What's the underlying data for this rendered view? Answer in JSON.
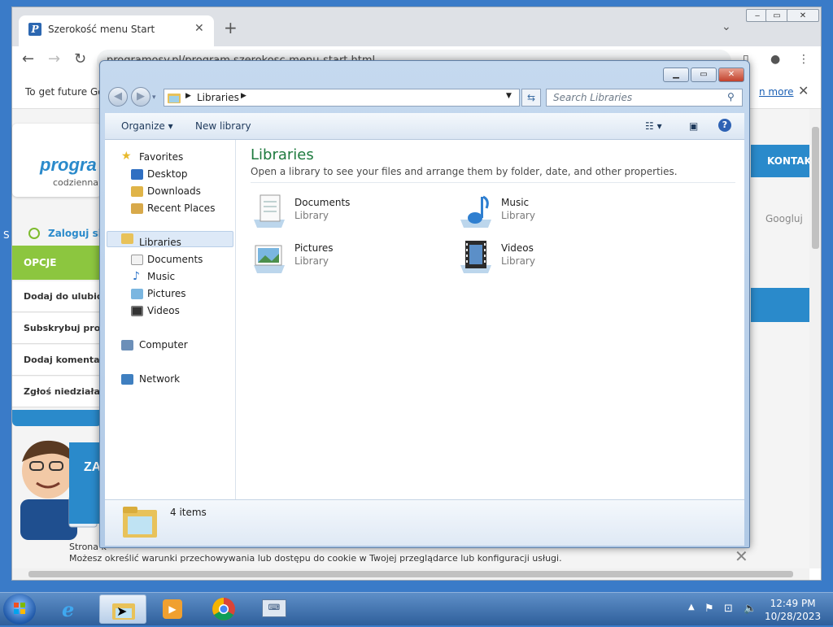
{
  "browser": {
    "tab_title": "Szerokość menu Start",
    "tab_favicon": "P",
    "url": "programosy.pl/program,szerokosc-menu-start.html",
    "infobar_text": "To get future Go",
    "infobar_link": "n more",
    "win_minimize": "‒",
    "win_maximize": "▭",
    "win_close": "✕"
  },
  "website": {
    "logo": "progra",
    "logo_sub": "codzienna",
    "login": "Zaloguj się",
    "options_header": "OPCJE PROGRA",
    "options": [
      "Dodaj do ulubion",
      "Subskrybuj progr",
      "Dodaj komentarz",
      "Zgłoś niedziałają"
    ],
    "promo": "ZA",
    "kontakt": "KONTAKT",
    "search_button": "Googluj",
    "cookie_line1": "Strona k",
    "cookie_line2": "Możesz określić warunki przechowywania lub dostępu do cookie w Twojej przeglądarce lub konfiguracji usługi.",
    "side_letter": "S"
  },
  "explorer": {
    "address": "Libraries",
    "search_placeholder": "Search Libraries",
    "toolbar": {
      "organize": "Organize",
      "new_library": "New library",
      "help": "?"
    },
    "nav": {
      "favorites": "Favorites",
      "favorites_items": [
        "Desktop",
        "Downloads",
        "Recent Places"
      ],
      "libraries": "Libraries",
      "libraries_items": [
        "Documents",
        "Music",
        "Pictures",
        "Videos"
      ],
      "computer": "Computer",
      "network": "Network"
    },
    "content": {
      "title": "Libraries",
      "description": "Open a library to see your files and arrange them by folder, date, and other properties.",
      "items": [
        {
          "name": "Documents",
          "type": "Library",
          "icon": "documents-library-icon"
        },
        {
          "name": "Music",
          "type": "Library",
          "icon": "music-library-icon"
        },
        {
          "name": "Pictures",
          "type": "Library",
          "icon": "pictures-library-icon"
        },
        {
          "name": "Videos",
          "type": "Library",
          "icon": "videos-library-icon"
        }
      ]
    },
    "details": {
      "count": "4 items"
    }
  },
  "taskbar": {
    "time": "12:49 PM",
    "date": "10/28/2023"
  },
  "colors": {
    "explorer_frame": "#b0c9e6",
    "library_title": "#1e7a3e",
    "site_accent": "#2a8acb",
    "site_green": "#8cc63f"
  }
}
